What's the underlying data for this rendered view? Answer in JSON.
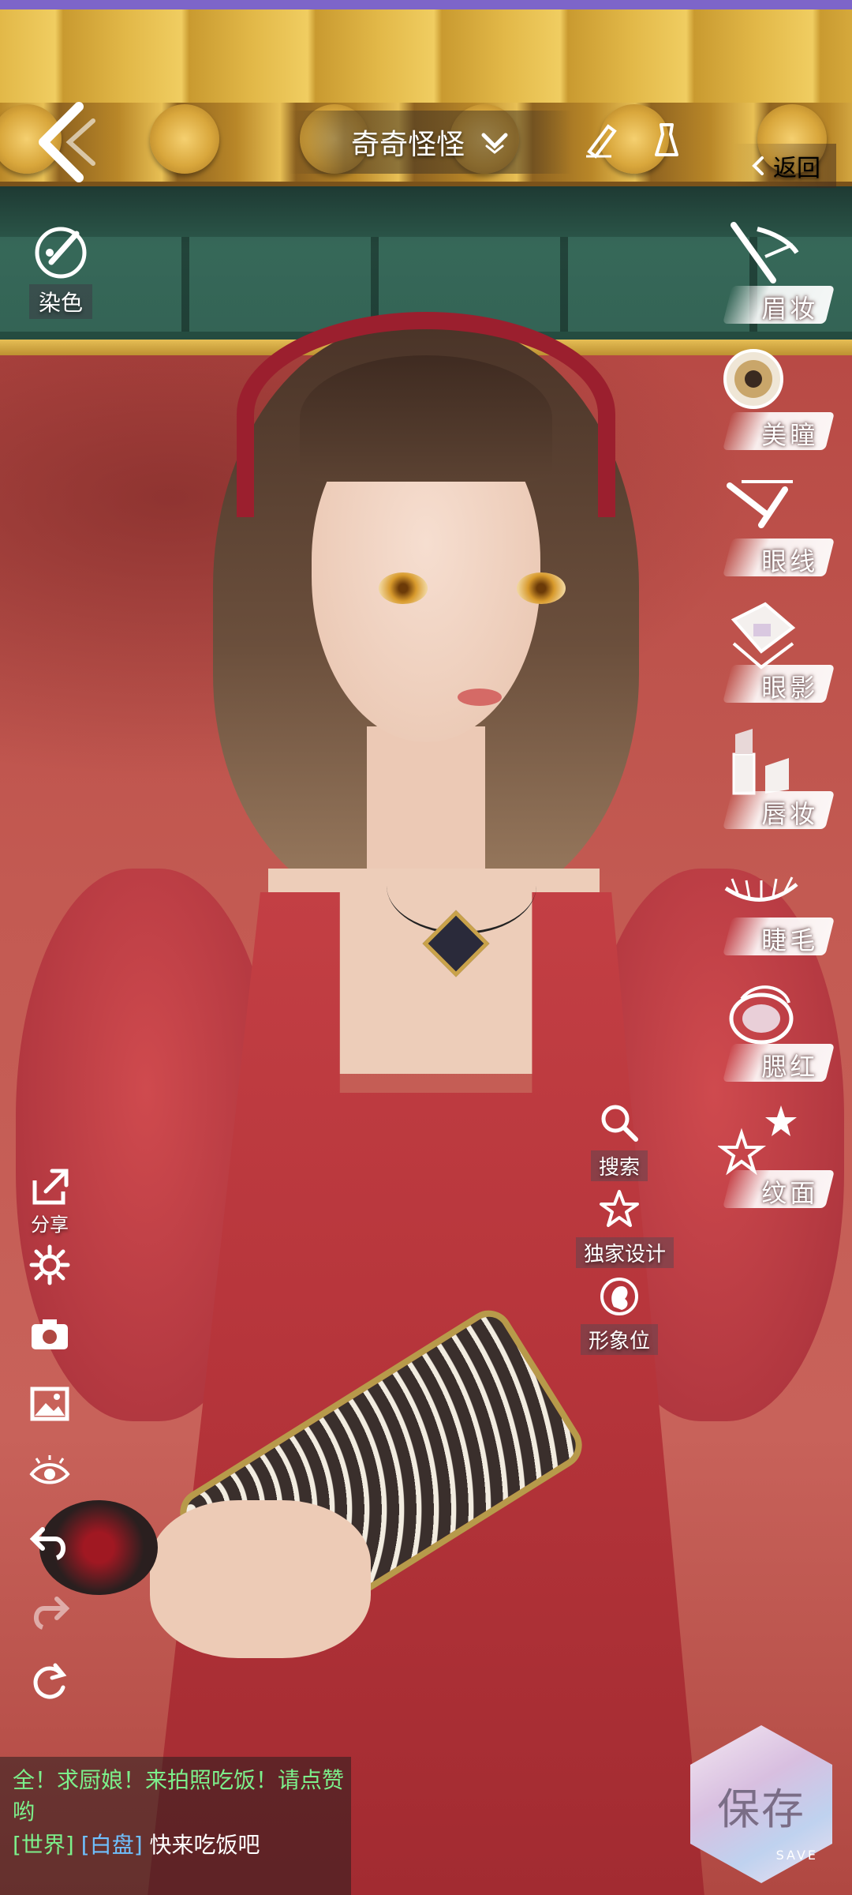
{
  "header": {
    "title": "奇奇怪怪",
    "return_label": "返回"
  },
  "dye": {
    "label": "染色"
  },
  "makeup_menu": [
    {
      "id": "brow",
      "label": "眉妆",
      "icon": "eyebrow-brush-icon"
    },
    {
      "id": "pupil",
      "label": "美瞳",
      "icon": "contact-lens-icon"
    },
    {
      "id": "eyeliner",
      "label": "眼线",
      "icon": "eyeliner-icon"
    },
    {
      "id": "eyeshadow",
      "label": "眼影",
      "icon": "eyeshadow-palette-icon"
    },
    {
      "id": "lip",
      "label": "唇妆",
      "icon": "lipstick-icon"
    },
    {
      "id": "lash",
      "label": "睫毛",
      "icon": "eyelash-icon"
    },
    {
      "id": "blush",
      "label": "腮红",
      "icon": "blush-compact-icon"
    },
    {
      "id": "face-tattoo",
      "label": "纹面",
      "icon": "stars-icon"
    }
  ],
  "mid_tools": [
    {
      "label": "搜索",
      "icon": "search-icon"
    },
    {
      "label": "独家设计",
      "icon": "star-outline-icon"
    },
    {
      "label": "形象位",
      "icon": "profile-silhouette-icon"
    }
  ],
  "left_tools": [
    {
      "label": "分享",
      "icon": "share-icon"
    },
    {
      "label": "",
      "icon": "gear-icon"
    },
    {
      "label": "",
      "icon": "camera-icon"
    },
    {
      "label": "",
      "icon": "image-icon"
    },
    {
      "label": "",
      "icon": "eye-icon"
    },
    {
      "label": "",
      "icon": "undo-icon"
    },
    {
      "label": "",
      "icon": "redo-icon"
    },
    {
      "label": "",
      "icon": "reset-icon"
    }
  ],
  "save": {
    "label": "保存",
    "sub": "SAVE"
  },
  "chat": {
    "line1": "全！求厨娘！来拍照吃饭！请点赞哟",
    "channel": "[世界]",
    "name": "[白盘]",
    "message": "快来吃饭吧"
  },
  "colors": {
    "accent_green": "#7cf08b",
    "name_blue": "#6fc0ff",
    "dress_red": "#c33f44",
    "wall_red": "#c35a52"
  }
}
